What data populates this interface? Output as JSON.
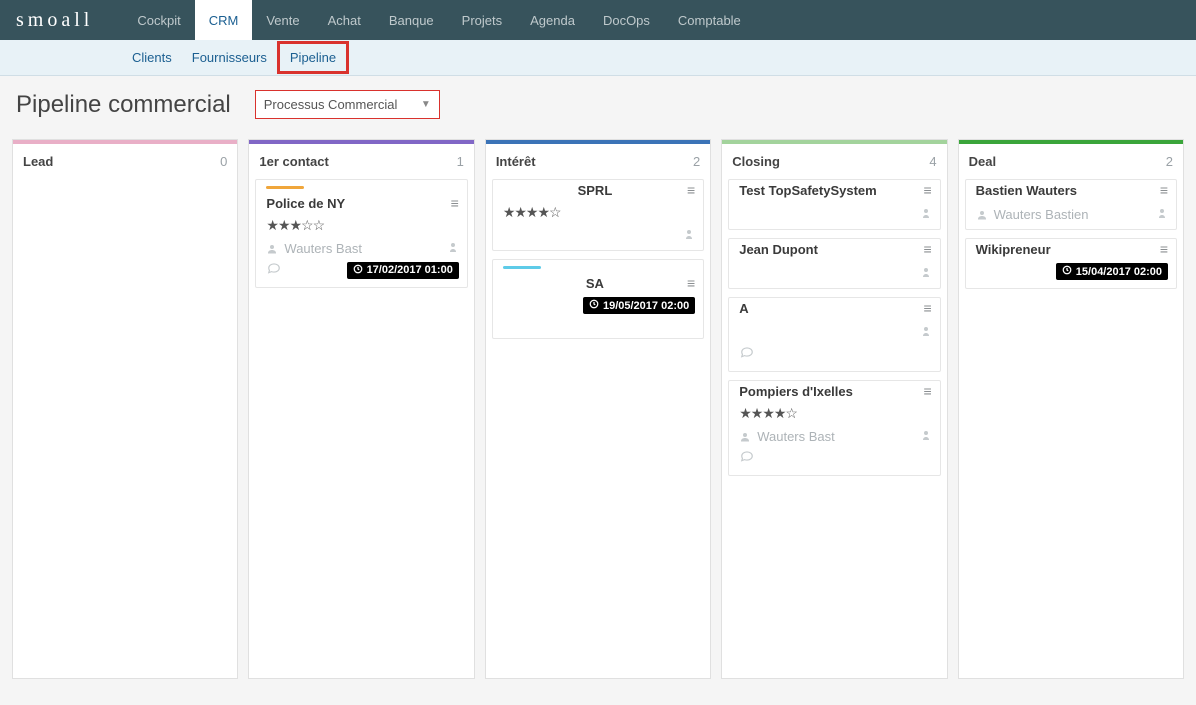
{
  "logo": "smoall",
  "nav": {
    "tabs": [
      "Cockpit",
      "CRM",
      "Vente",
      "Achat",
      "Banque",
      "Projets",
      "Agenda",
      "DocOps",
      "Comptable"
    ],
    "active": "CRM"
  },
  "subnav": {
    "items": [
      "Clients",
      "Fournisseurs",
      "Pipeline"
    ],
    "highlighted": "Pipeline"
  },
  "page": {
    "title": "Pipeline commercial",
    "process_selected": "Processus Commercial"
  },
  "columns": [
    {
      "id": "lead",
      "title": "Lead",
      "count": 0,
      "color": "#e9afc7",
      "cards": []
    },
    {
      "id": "contact1",
      "title": "1er contact",
      "count": 1,
      "color": "#8167c6",
      "cards": [
        {
          "accent": "#f0a63b",
          "title": "Police de NY",
          "stars": 3,
          "contact": "Wauters Bast",
          "has_chat": true,
          "has_avatar_side": true,
          "date": "17/02/2017 01:00"
        }
      ]
    },
    {
      "id": "interet",
      "title": "Intérêt",
      "count": 2,
      "color": "#3b73b7",
      "cards": [
        {
          "title": "SPRL",
          "title_center": true,
          "stars": 4,
          "has_avatar_side": true
        },
        {
          "accent": "#5ecbe8",
          "title": "SA",
          "title_center": true,
          "has_avatar_side": false,
          "date": "19/05/2017 02:00",
          "tall": true
        }
      ]
    },
    {
      "id": "closing",
      "title": "Closing",
      "count": 4,
      "color": "#a3d39c",
      "cards": [
        {
          "title": "Test TopSafetySystem",
          "has_avatar_side": true
        },
        {
          "title": "Jean Dupont",
          "has_avatar_side": true
        },
        {
          "title": "A",
          "has_avatar_side": true,
          "has_chat": true
        },
        {
          "title": "Pompiers d'Ixelles",
          "stars": 4,
          "contact": "Wauters Bast",
          "has_avatar_side": true,
          "has_chat": true
        }
      ]
    },
    {
      "id": "deal",
      "title": "Deal",
      "count": 2,
      "color": "#3aa53a",
      "cards": [
        {
          "title": "Bastien Wauters",
          "contact": "Wauters Bastien",
          "has_avatar_side": true
        },
        {
          "title": "Wikipreneur",
          "date": "15/04/2017 02:00"
        }
      ]
    }
  ]
}
